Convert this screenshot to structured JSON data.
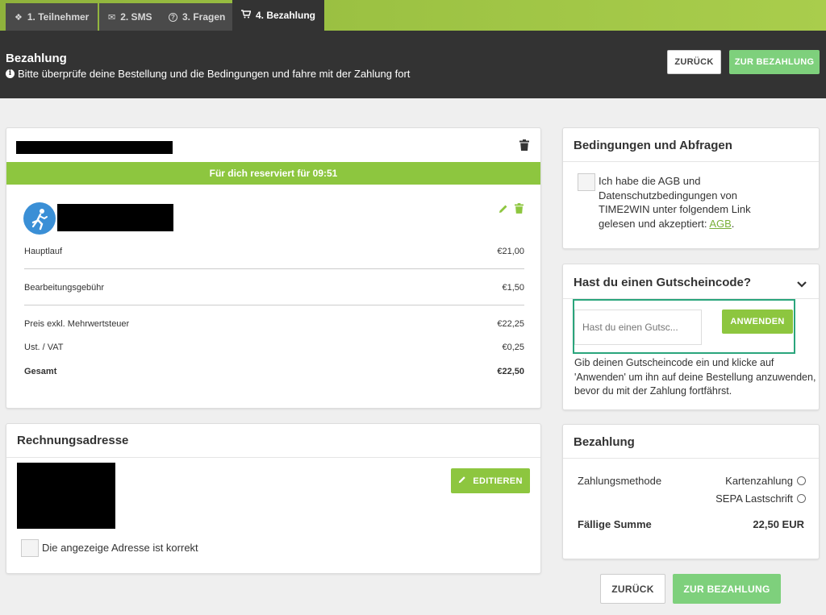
{
  "tabs": [
    {
      "icon": "ticket-icon",
      "glyph": "❖",
      "label": "1. Teilnehmer"
    },
    {
      "icon": "chat-icon",
      "glyph": "✉",
      "label": "2. SMS"
    },
    {
      "icon": "question-icon",
      "glyph": "?",
      "label": "3. Fragen"
    },
    {
      "icon": "cart-icon",
      "glyph": "⌂",
      "label": "4. Bezahlung"
    }
  ],
  "header": {
    "title": "Bezahlung",
    "subtitle": "Bitte überprüfe deine Bestellung und die Bedingungen und fahre mit der Zahlung fort",
    "back_label": "ZURÜCK",
    "pay_label": "ZUR BEZAHLUNG"
  },
  "order": {
    "reserved_text": "Für dich reserviert für 09:51",
    "items": [
      {
        "label": "Hauptlauf",
        "value": "€21,00"
      },
      {
        "label": "Bearbeitungsgebühr",
        "value": "€1,50"
      },
      {
        "label": "Preis exkl. Mehrwertsteuer",
        "value": "€22,25"
      },
      {
        "label": "Ust. / VAT",
        "value": "€0,25"
      },
      {
        "label": "Gesamt",
        "value": "€22,50"
      }
    ]
  },
  "billing": {
    "title": "Rechnungsadresse",
    "edit_label": "EDITIEREN",
    "confirm_label": "Die angezeige Adresse ist korrekt"
  },
  "terms": {
    "title": "Bedingungen und Abfragen",
    "text": "Ich habe die AGB und Datenschutzbedingungen von TIME2WIN unter folgendem Link gelesen und akzeptiert: ",
    "link": "AGB",
    "after": "."
  },
  "voucher": {
    "title": "Hast du einen Gutscheincode?",
    "placeholder": "Hast du einen Gutsc...",
    "apply_label": "ANWENDEN",
    "help": "Gib deinen Gutscheincode ein und klicke auf 'Anwenden' um ihn auf deine Bestellung anzuwenden, bevor du mit der Zahlung fortfährst."
  },
  "payment": {
    "title": "Bezahlung",
    "method_label": "Zahlungsmethode",
    "options": [
      "Kartenzahlung",
      "SEPA Lastschrift"
    ],
    "due_label": "Fällige Summe",
    "due_value": "22,50 EUR"
  },
  "footer": {
    "back_label": "ZURÜCK",
    "pay_label": "ZUR BEZAHLUNG"
  },
  "colors": {
    "accent_green": "#8dc63f",
    "pay_green": "#7ed07c",
    "highlight_teal": "#2aa57c",
    "runner_blue": "#3a8fd6"
  }
}
